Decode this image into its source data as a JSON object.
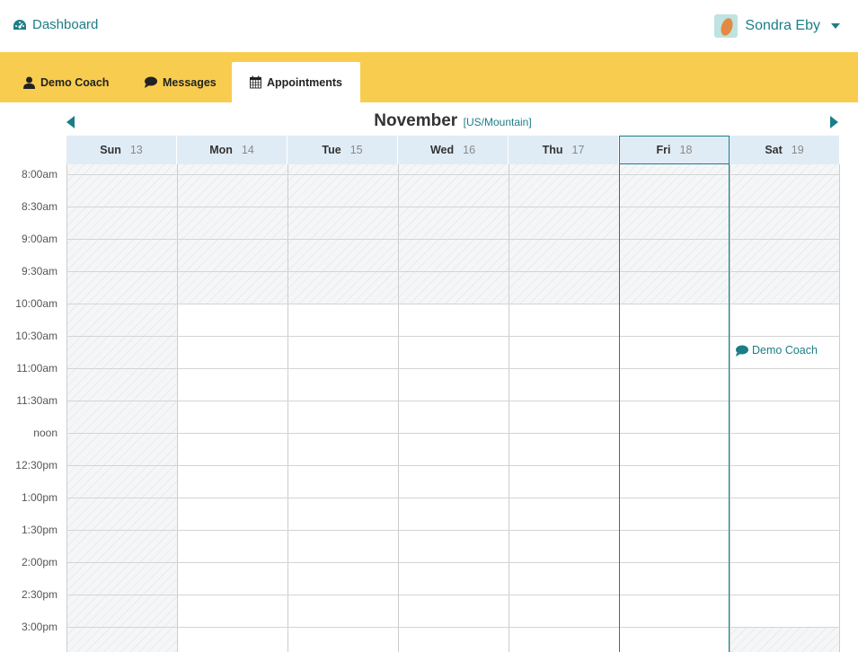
{
  "header": {
    "dashboard_label": "Dashboard",
    "user_name": "Sondra Eby"
  },
  "tabs": [
    {
      "label": "Demo Coach",
      "icon": "user-icon"
    },
    {
      "label": "Messages",
      "icon": "chat-bubble-icon"
    },
    {
      "label": "Appointments",
      "icon": "calendar-icon",
      "active": true
    }
  ],
  "calendar": {
    "month": "November",
    "timezone": "[US/Mountain]",
    "days": [
      {
        "name": "Sun",
        "date": "13"
      },
      {
        "name": "Mon",
        "date": "14"
      },
      {
        "name": "Tue",
        "date": "15"
      },
      {
        "name": "Wed",
        "date": "16"
      },
      {
        "name": "Thu",
        "date": "17"
      },
      {
        "name": "Fri",
        "date": "18",
        "today": true
      },
      {
        "name": "Sat",
        "date": "19"
      }
    ],
    "times": [
      "8:00am",
      "8:30am",
      "9:00am",
      "9:30am",
      "10:00am",
      "10:30am",
      "11:00am",
      "11:30am",
      "noon",
      "12:30pm",
      "1:00pm",
      "1:30pm",
      "2:00pm",
      "2:30pm",
      "3:00pm"
    ],
    "event": {
      "label": "Demo Coach",
      "day": "Sat",
      "time": "10:30am"
    }
  },
  "colors": {
    "accent": "#1b7e86",
    "tabbar": "#f8cd4f",
    "dayheader": "#e0ecf5"
  }
}
